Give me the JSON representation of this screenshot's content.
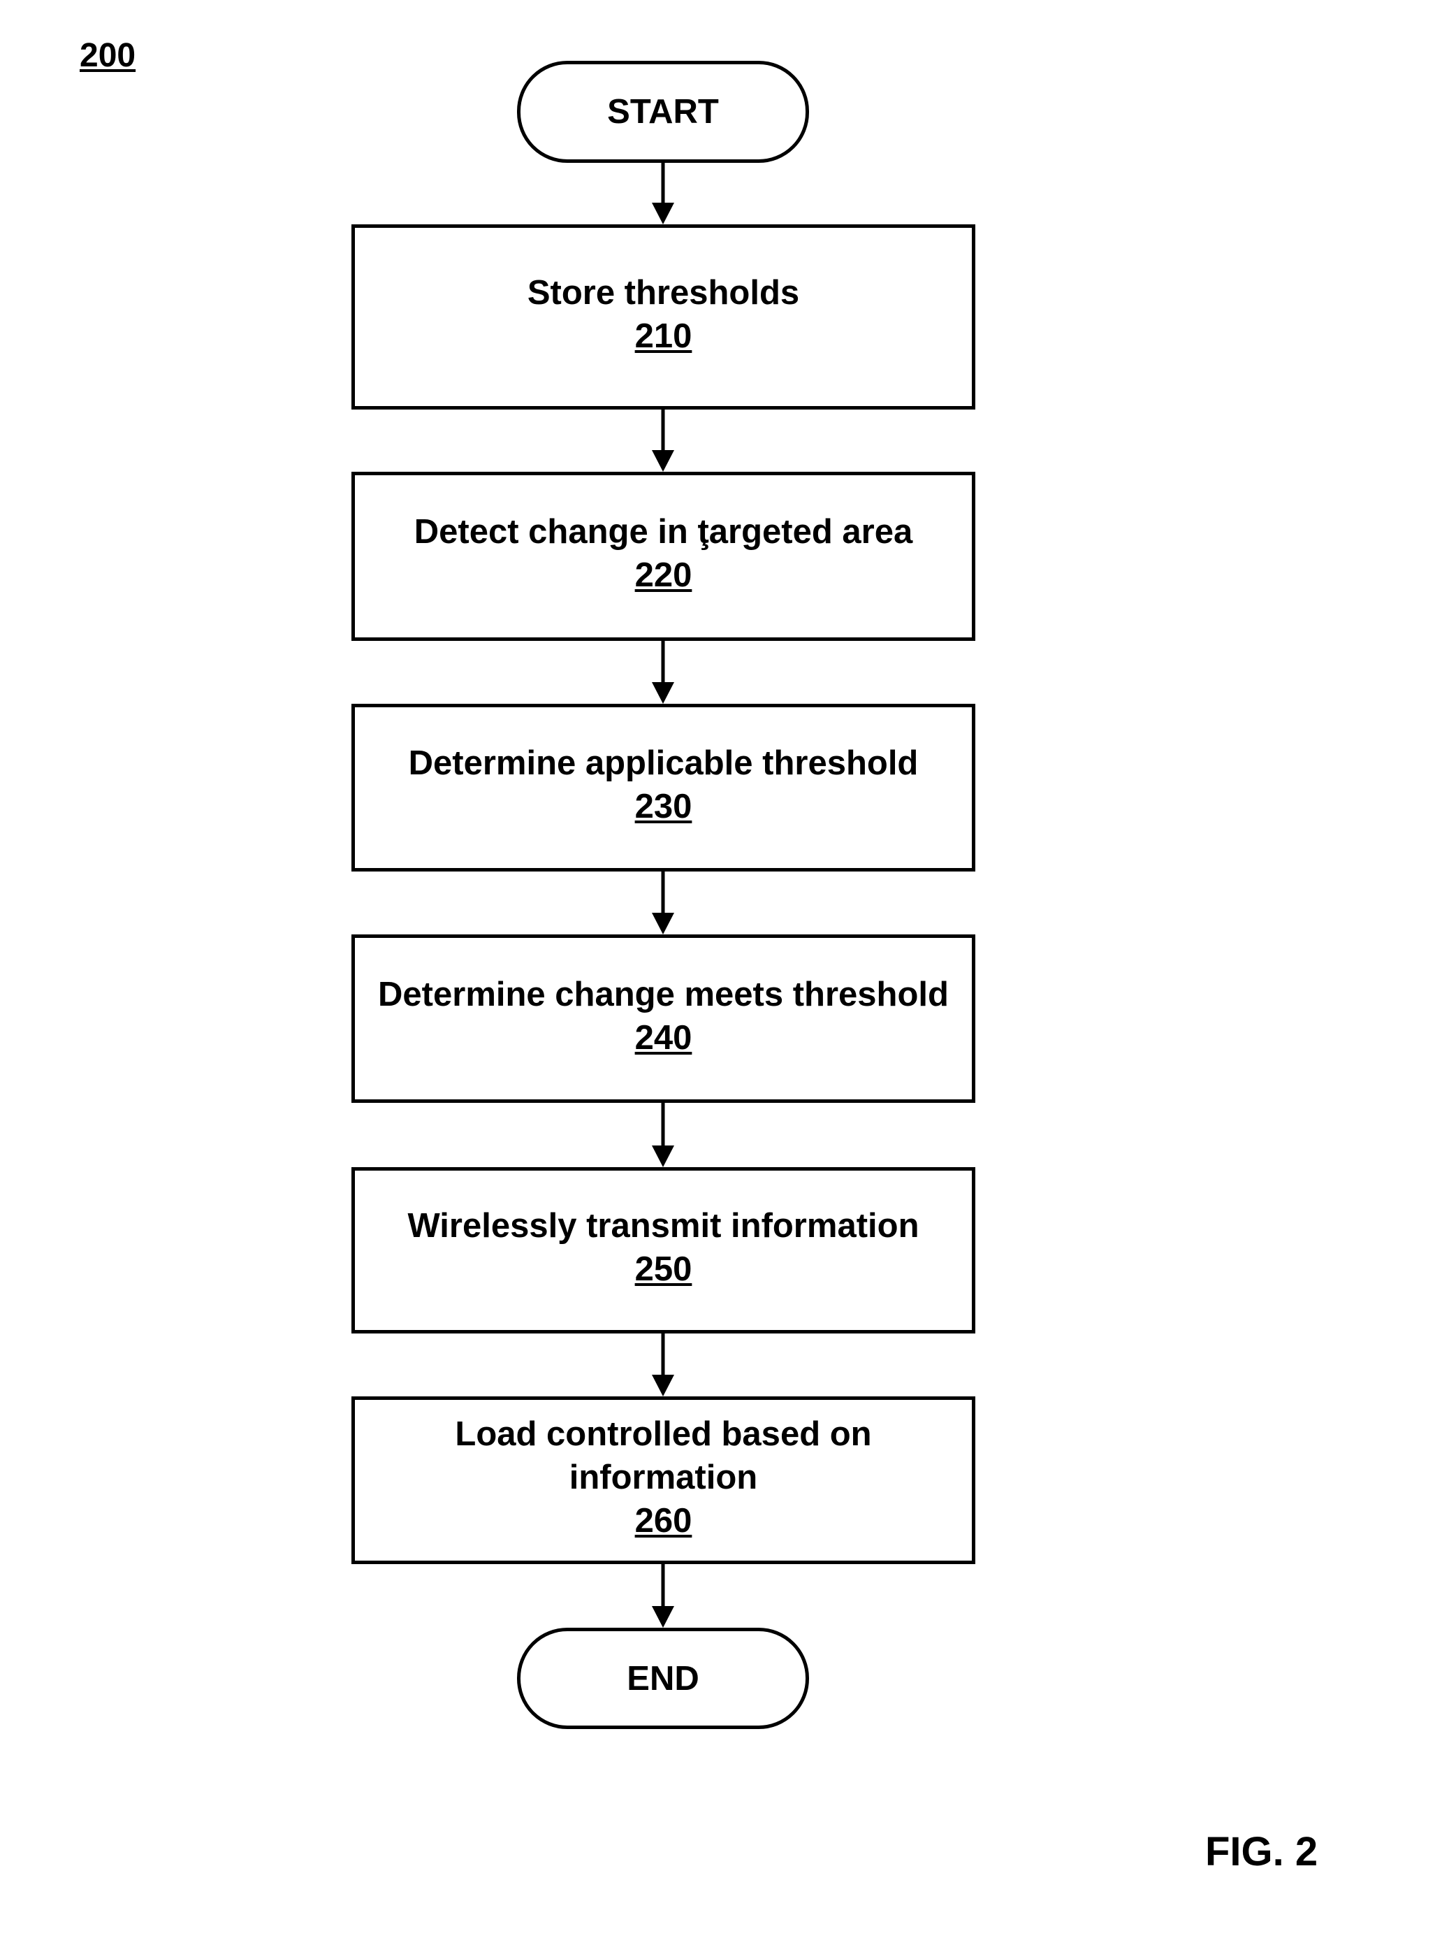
{
  "figure": {
    "reference_numeral": "200",
    "caption": "FIG. 2"
  },
  "flowchart": {
    "start": {
      "label": "START"
    },
    "steps": [
      {
        "label": "Store thresholds",
        "number": "210"
      },
      {
        "label": "Detect change in ţargeted area",
        "number": "220"
      },
      {
        "label": "Determine applicable threshold",
        "number": "230"
      },
      {
        "label": "Determine change meets threshold",
        "number": "240"
      },
      {
        "label": "Wirelessly transmit information",
        "number": "250"
      },
      {
        "label": "Load controlled based on\ninformation",
        "number": "260"
      }
    ],
    "end": {
      "label": "END"
    },
    "edges": [
      [
        "START",
        "210"
      ],
      [
        "210",
        "220"
      ],
      [
        "220",
        "230"
      ],
      [
        "230",
        "240"
      ],
      [
        "240",
        "250"
      ],
      [
        "250",
        "260"
      ],
      [
        "260",
        "END"
      ]
    ]
  }
}
